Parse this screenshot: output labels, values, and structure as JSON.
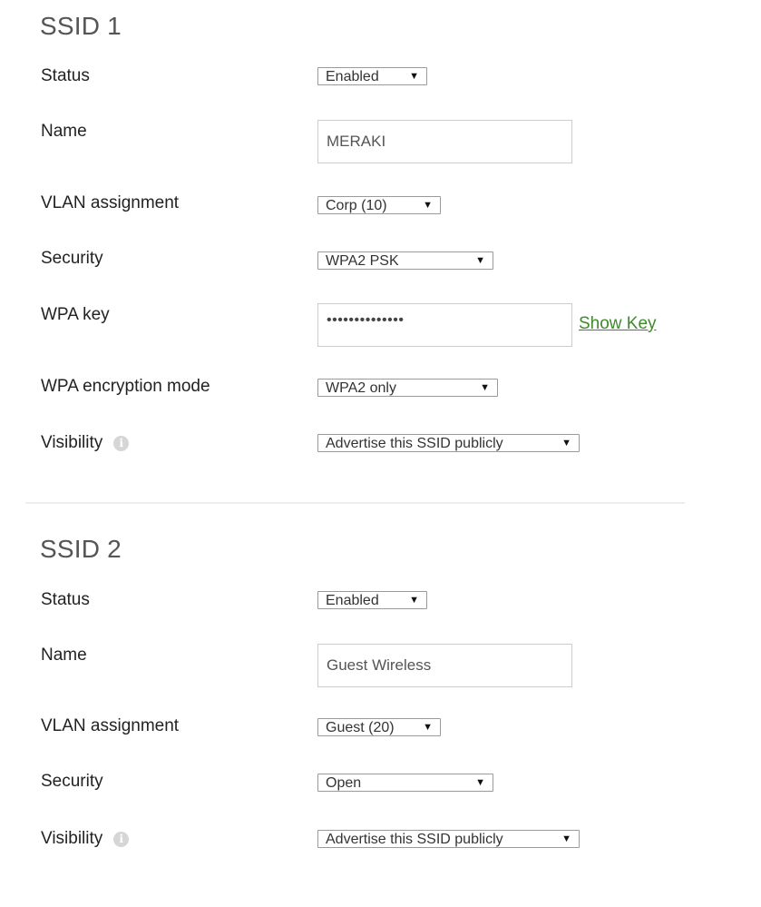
{
  "sections": [
    {
      "title": "SSID 1",
      "status": {
        "label": "Status",
        "value": "Enabled"
      },
      "name": {
        "label": "Name",
        "value": "MERAKI"
      },
      "vlan": {
        "label": "VLAN assignment",
        "value": "Corp (10)"
      },
      "security": {
        "label": "Security",
        "value": "WPA2 PSK"
      },
      "wpa_key": {
        "label": "WPA key",
        "value": "••••••••••••••",
        "show_key_label": "Show Key"
      },
      "wpa_mode": {
        "label": "WPA encryption mode",
        "value": "WPA2 only"
      },
      "visibility": {
        "label": "Visibility",
        "value": "Advertise this SSID publicly",
        "icon": "info-icon"
      }
    },
    {
      "title": "SSID 2",
      "status": {
        "label": "Status",
        "value": "Enabled"
      },
      "name": {
        "label": "Name",
        "value": "Guest Wireless"
      },
      "vlan": {
        "label": "VLAN assignment",
        "value": "Guest (20)"
      },
      "security": {
        "label": "Security",
        "value": "Open"
      },
      "visibility": {
        "label": "Visibility",
        "value": "Advertise this SSID publicly",
        "icon": "info-icon"
      }
    }
  ],
  "icons": {
    "dropdown_arrow": "▼",
    "info": "i"
  },
  "colors": {
    "link": "#3d8b2c",
    "title": "#555555",
    "divider": "#eeeeee"
  }
}
